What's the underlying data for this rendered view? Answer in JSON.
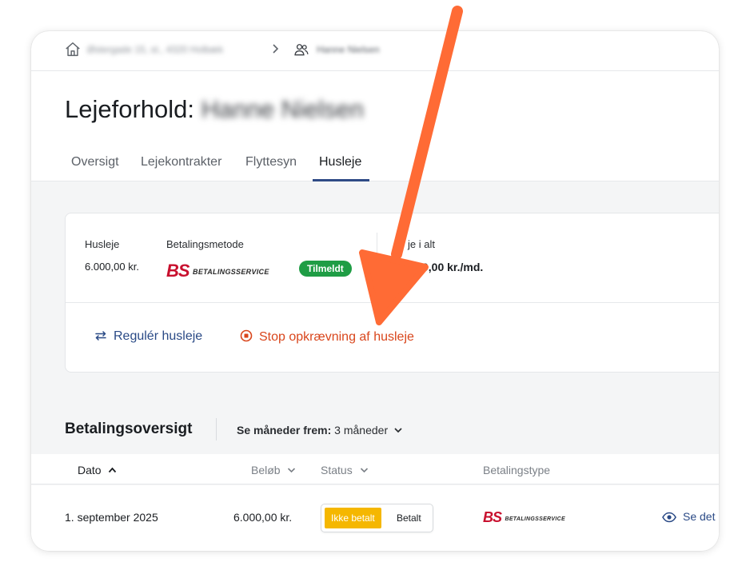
{
  "breadcrumb": {
    "address": "Østergade 15, st., 4320 Holbæk",
    "tenant": "Hanne Nielsen"
  },
  "page": {
    "title_prefix": "Lejeforhold:",
    "title_name": "Hanne Nielsen"
  },
  "tabs": [
    {
      "label": "Oversigt",
      "active": false
    },
    {
      "label": "Lejekontrakter",
      "active": false
    },
    {
      "label": "Flyttesyn",
      "active": false
    },
    {
      "label": "Husleje",
      "active": true
    }
  ],
  "rent": {
    "rent_label": "Husleje",
    "rent_value": "6.000,00 kr.",
    "method_label": "Betalingsmetode",
    "method_logo_text": "BETALINGSSERVICE",
    "method_status": "Tilmeldt",
    "total_label": "je i alt",
    "total_value": "0,00 kr./md."
  },
  "actions": {
    "adjust": "Regulér husleje",
    "stop": "Stop opkrævning af husleje"
  },
  "payments": {
    "title": "Betalingsoversigt",
    "months_label": "Se måneder frem:",
    "months_value": "3 måneder",
    "columns": {
      "date": "Dato",
      "amount": "Beløb",
      "status": "Status",
      "type": "Betalingstype"
    },
    "rows": [
      {
        "date": "1. september 2025",
        "amount": "6.000,00 kr.",
        "status_unpaid": "Ikke betalt",
        "status_paid": "Betalt",
        "type_logo_text": "BETALINGSSERVICE",
        "details": "Se det"
      }
    ]
  },
  "colors": {
    "accent": "#2f4b86",
    "danger": "#d9461c",
    "success": "#1f9d45",
    "warning": "#f5b700",
    "annotation_arrow": "#ff6b35"
  },
  "icons": {
    "home": "home-icon",
    "chevron": "chevron-right-icon",
    "people": "people-icon",
    "swap": "swap-arrows-icon",
    "stop": "stop-circle-icon",
    "eye": "eye-icon"
  }
}
